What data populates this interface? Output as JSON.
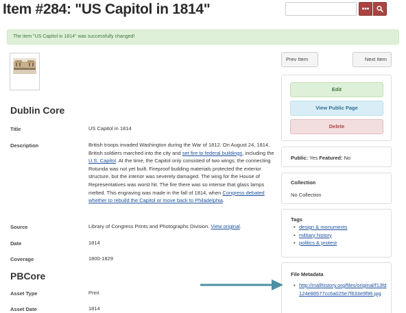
{
  "page": {
    "title": "Item #284: \"US Capitol in 1814\""
  },
  "header": {
    "search_placeholder": "",
    "more_label": "•••",
    "search_icon": "search-icon",
    "accent_color": "#a94442"
  },
  "flash": {
    "message": "The item \"US Capitol in 1814\" was successfully changed!"
  },
  "navigation": {
    "prev_label": "Prev Item",
    "next_label": "Next Item"
  },
  "actions": {
    "edit_label": "Edit",
    "view_public_label": "View Public Page",
    "delete_label": "Delete"
  },
  "public_featured": {
    "public_label": "Public:",
    "public_value": "Yes",
    "featured_label": "Featured:",
    "featured_value": "No"
  },
  "collection": {
    "title": "Collection",
    "value": "No Collection"
  },
  "tags": {
    "title": "Tags",
    "items": [
      "design & monuments",
      "military history",
      "politics & protest"
    ]
  },
  "file_metadata": {
    "title": "File Metadata",
    "url": "http://mallhistory.org/files/original/f13fd124e88577cc6a025e7f633e9f96.jpg"
  },
  "dublin_core": {
    "heading": "Dublin Core",
    "title_label": "Title",
    "title_value": "US Capitol in 1814",
    "description_label": "Description",
    "description": {
      "part1": "British troops invaded Washington during the War of 1812. On August 24, 1814, British soldiers marched into the city and ",
      "link1": "set fire to federal buildings",
      "part2": ", including the ",
      "link2": "U.S. Capitol",
      "part3": ". At the time, the Capitol only consisted of two wings; the connecting Rotunda was not yet built. Fireproof building materials protected the exterior structure, but the interior was severely damaged. The wing for the House of Representatives was worst hit. The fire there was so intense that glass lamps melted. This engraving was made in the fall of 1814, when ",
      "link3": "Congress debated whether to rebuild the Capitol or move back to Philadelphia",
      "part4": "."
    },
    "source_label": "Source",
    "source_text": "Library of Congress Prints and Photographs Division. ",
    "source_link": "View original",
    "source_end": ".",
    "date_label": "Date",
    "date_value": "1814",
    "coverage_label": "Coverage",
    "coverage_value": "1800-1829"
  },
  "pbcore": {
    "heading": "PBCore",
    "asset_type_label": "Asset Type",
    "asset_type_value": "Print",
    "asset_date_label": "Asset Date",
    "asset_date_value": "1814"
  },
  "annotation": {
    "arrow_color": "#4a8fa3"
  }
}
